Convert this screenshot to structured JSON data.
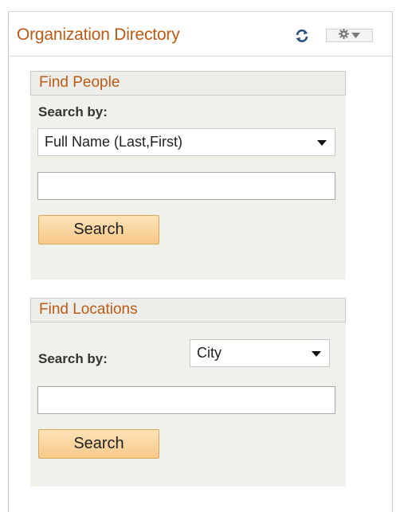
{
  "header": {
    "title": "Organization Directory",
    "refresh_icon": "refresh-icon",
    "menu_icon": "gear-icon"
  },
  "find_people": {
    "title": "Find People",
    "search_by_label": "Search by:",
    "selected_option": "Full Name (Last,First)",
    "query_value": "",
    "search_button": "Search"
  },
  "find_locations": {
    "title": "Find Locations",
    "search_by_label": "Search by:",
    "selected_option": "City",
    "query_value": "",
    "search_button": "Search"
  },
  "colors": {
    "title": "#bb5a14",
    "section_bg": "#f1f1ec",
    "button_bg": "#f7c98a"
  }
}
